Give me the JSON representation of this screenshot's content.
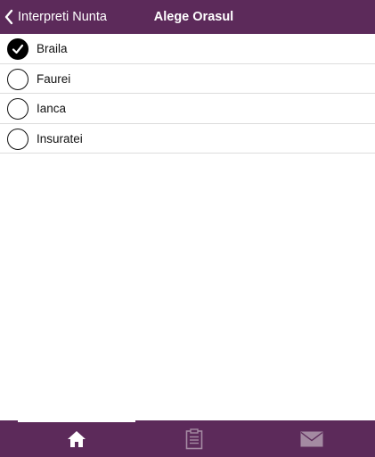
{
  "header": {
    "back_label": "Interpreti Nunta",
    "title": "Alege Orasul"
  },
  "cities": [
    {
      "name": "Braila",
      "selected": true
    },
    {
      "name": "Faurei",
      "selected": false
    },
    {
      "name": "Ianca",
      "selected": false
    },
    {
      "name": "Insuratei",
      "selected": false
    }
  ],
  "tabs": [
    {
      "icon": "home-icon",
      "active": true
    },
    {
      "icon": "clipboard-icon",
      "active": false
    },
    {
      "icon": "envelope-icon",
      "active": false
    }
  ],
  "colors": {
    "brand": "#5c2a5a",
    "active_icon": "#ffffff",
    "inactive_icon": "#a48aa2"
  }
}
